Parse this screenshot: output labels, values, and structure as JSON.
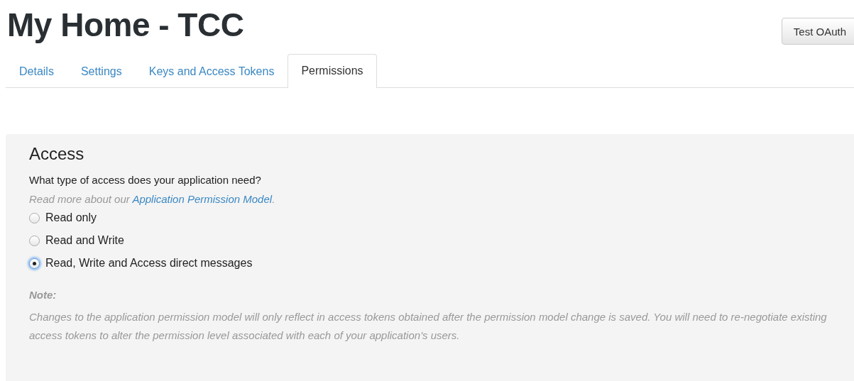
{
  "page": {
    "title": "My Home - TCC",
    "action_button": "Test OAuth"
  },
  "tabs": [
    {
      "label": "Details",
      "selected": false
    },
    {
      "label": "Settings",
      "selected": false
    },
    {
      "label": "Keys and Access Tokens",
      "selected": false
    },
    {
      "label": "Permissions",
      "selected": true
    }
  ],
  "access": {
    "heading": "Access",
    "question": "What type of access does your application need?",
    "read_more": "Read more about our ",
    "link": "Application Permission Model",
    "read_more_end": ".",
    "options": [
      {
        "label": "Read only",
        "selected": false
      },
      {
        "label": "Read and Write",
        "selected": false
      },
      {
        "label": "Read, Write and Access direct messages",
        "selected": true
      }
    ],
    "note_label": "Note:",
    "note": "Changes to the application permission model will only reflect in access tokens obtained after the permission model change is saved. You will need to re-negotiate existing access tokens to alter the permission level associated with each of your application's users."
  }
}
